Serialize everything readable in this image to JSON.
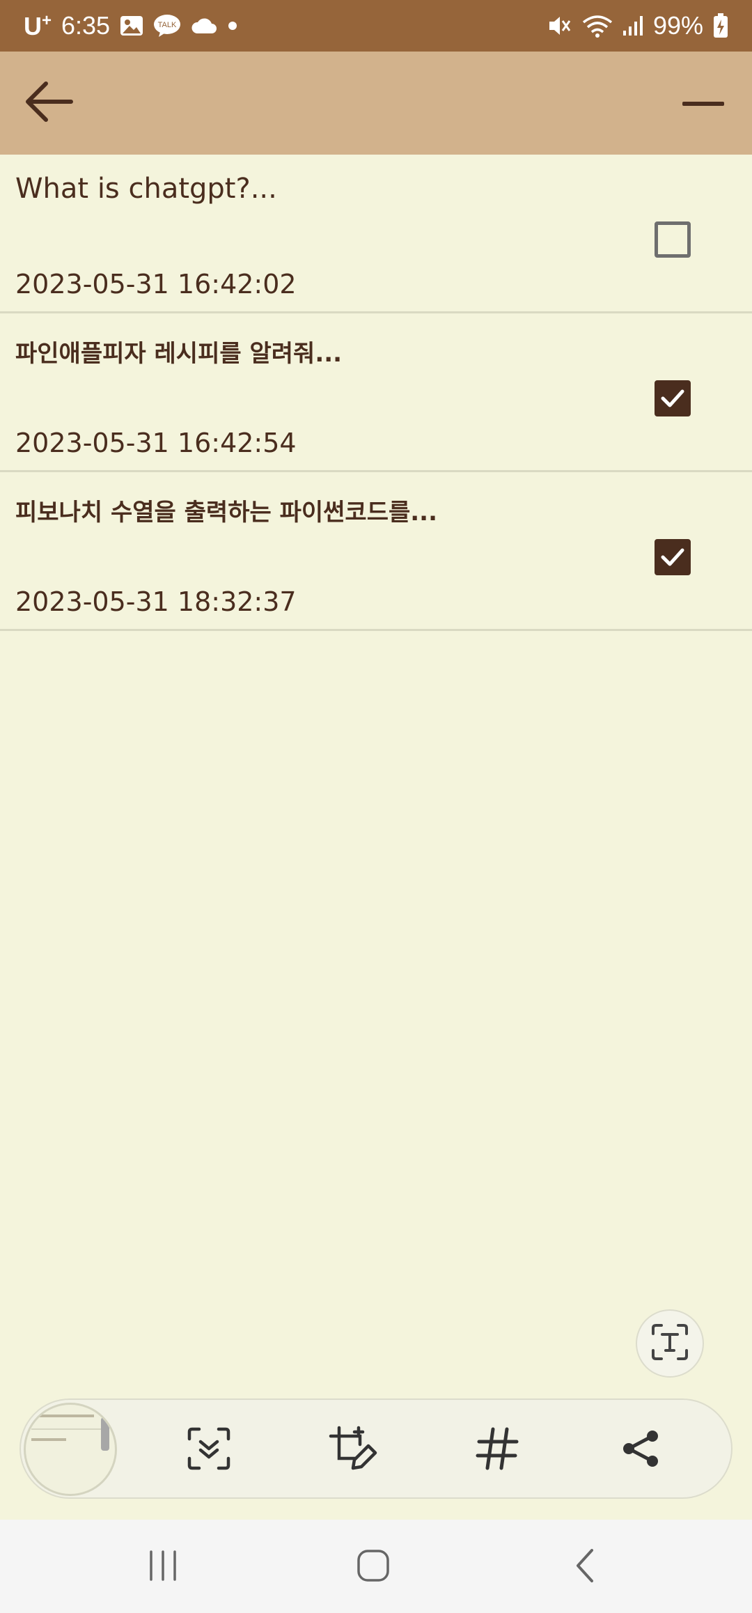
{
  "status_bar": {
    "carrier": "U",
    "carrier_sup": "+",
    "time": "6:35",
    "battery": "99%",
    "icons_left": [
      "gallery-icon",
      "kakaotalk-icon",
      "cloud-icon",
      "dot-icon"
    ],
    "icons_right": [
      "mute-icon",
      "wifi-icon",
      "signal-icon",
      "battery-charging-icon"
    ],
    "talk_label": "TALK"
  },
  "app_bar": {
    "back_icon": "arrow-left-icon",
    "minimize_icon": "minus-icon",
    "color": "#d2b28c"
  },
  "notes": [
    {
      "title": "What is chatgpt?...",
      "date": "2023-05-31 16:42:02",
      "checked": false
    },
    {
      "title": "파인애플피자 레시피를 알려줘...",
      "date": "2023-05-31 16:42:54",
      "checked": true
    },
    {
      "title": "피보나치 수열을 출력하는 파이썬코드를...",
      "date": "2023-05-31 18:32:37",
      "checked": true
    }
  ],
  "floating": {
    "ocr_icon": "text-extract-icon"
  },
  "toolbar": {
    "thumbnail": "screenshot-thumbnail",
    "tools": [
      "scroll-capture-icon",
      "edit-crop-icon",
      "hashtag-icon",
      "share-icon"
    ]
  },
  "nav_bar": {
    "buttons": [
      "recent-apps-icon",
      "home-icon",
      "back-icon"
    ]
  },
  "colors": {
    "accent": "#4a2d1e",
    "status_bar": "#96653a",
    "background": "#f4f4dc"
  }
}
